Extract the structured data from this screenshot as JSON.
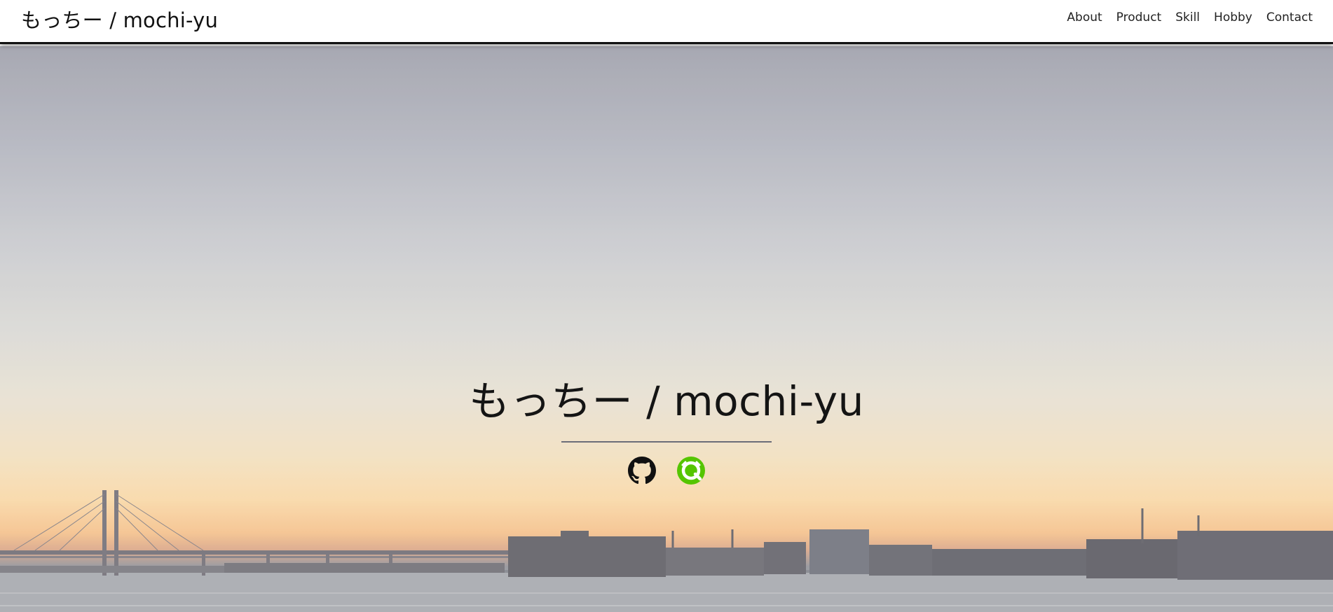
{
  "navbar": {
    "brand": "もっちー / mochi-yu",
    "links": [
      {
        "label": "About"
      },
      {
        "label": "Product"
      },
      {
        "label": "Skill"
      },
      {
        "label": "Hobby"
      },
      {
        "label": "Contact"
      }
    ]
  },
  "hero": {
    "title": "もっちー / mochi-yu",
    "social_icons": [
      "github-icon",
      "qiita-icon"
    ]
  },
  "colors": {
    "qiita_green": "#55c500",
    "github_black": "#111111",
    "divider": "#6b6d78"
  }
}
